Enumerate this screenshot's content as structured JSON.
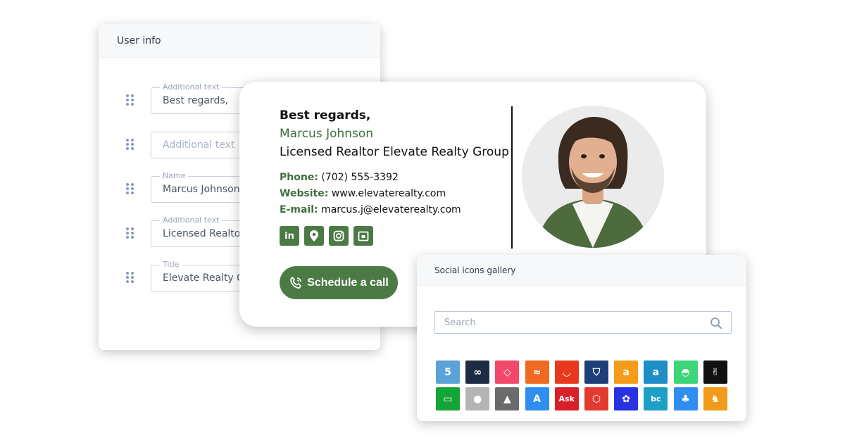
{
  "user_info": {
    "title": "User info",
    "fields": [
      {
        "label": "Additional text",
        "value": "Best regards,"
      },
      {
        "label": "",
        "value": "",
        "placeholder": "Additional text"
      },
      {
        "label": "Name",
        "value": "Marcus Johnson"
      },
      {
        "label": "Additional text",
        "value": "Licensed Realtor"
      },
      {
        "label": "Title",
        "value": "Elevate Realty Group"
      }
    ]
  },
  "signature": {
    "greeting": "Best regards,",
    "name": "Marcus Johnson",
    "title": "Licensed Realtor Elevate Realty Group",
    "contacts": [
      {
        "label": "Phone:",
        "value": "(702) 555-3392"
      },
      {
        "label": "Website:",
        "value": "www.elevaterealty.com"
      },
      {
        "label": "E-mail:",
        "value": "marcus.j@elevaterealty.com"
      }
    ],
    "social_icons": [
      "linkedin-icon",
      "location-pin-icon",
      "instagram-icon",
      "calendar-icon"
    ],
    "cta_label": "Schedule a call",
    "accent_color": "#4b7a45",
    "name_color": "#3e7040"
  },
  "gallery": {
    "title": "Social icons gallery",
    "search_placeholder": "Search",
    "icons": [
      {
        "name": "500px-icon",
        "color": "#5aa3d8"
      },
      {
        "name": "chain-link-icon",
        "color": "#1d2c45"
      },
      {
        "name": "airbnb-icon",
        "color": "#f2486a"
      },
      {
        "name": "alibaba-icon",
        "color": "#f06a23"
      },
      {
        "name": "aliexpress-icon",
        "color": "#e8391f"
      },
      {
        "name": "alliance-icon",
        "color": "#1f3f7a"
      },
      {
        "name": "amazon-icon",
        "color": "#f59c1a"
      },
      {
        "name": "amazon-a-icon",
        "color": "#1f8ec7"
      },
      {
        "name": "android-icon",
        "color": "#3ed57a"
      },
      {
        "name": "angellist-icon",
        "color": "#111111"
      },
      {
        "name": "speech-bubble-icon",
        "color": "#13a538"
      },
      {
        "name": "apple-icon",
        "color": "#b4b4b4"
      },
      {
        "name": "archlinux-icon",
        "color": "#6b6b6b"
      },
      {
        "name": "app-store-icon",
        "color": "#2f8ef0"
      },
      {
        "name": "ask-icon",
        "color": "#d9202a"
      },
      {
        "name": "cube-icon",
        "color": "#e33a2f"
      },
      {
        "name": "baidu-icon",
        "color": "#2932e1"
      },
      {
        "name": "bandcamp-icon",
        "color": "#1da0c3"
      },
      {
        "name": "tree-icon",
        "color": "#2f8ef0"
      },
      {
        "name": "squirrel-icon",
        "color": "#f29a1a"
      }
    ]
  }
}
